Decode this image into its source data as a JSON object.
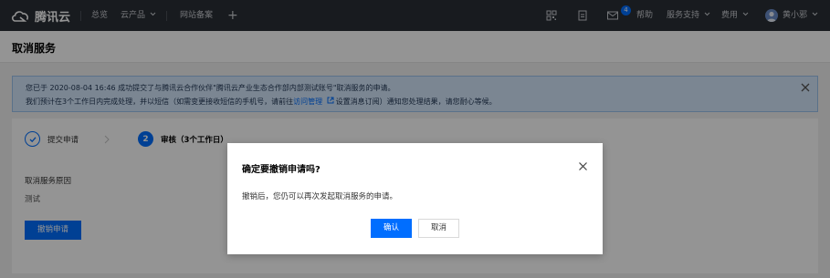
{
  "nav": {
    "brand": "腾讯云",
    "overview": "总览",
    "products": "云产品",
    "filing": "网站备案",
    "plus": "+",
    "message_count": "4",
    "help": "帮助",
    "support": "服务支持",
    "billing": "费用",
    "username": "黄小邪"
  },
  "page": {
    "title": "取消服务"
  },
  "notice": {
    "line1": "您已于 2020-08-04 16:46 成功提交了与腾讯云合作伙伴\"腾讯云产业生态合作部内部测试账号\"取消服务的申请。",
    "line2_before": "我们预计在3个工作日内完成处理，并以短信（如需变更接收短信的手机号，请前往",
    "line2_link": "访问管理",
    "line2_after": "设置消息订阅）通知您处理结果，请您耐心等候。"
  },
  "steps": [
    {
      "label": "提交申请"
    },
    {
      "number": "2",
      "label": "审核（3个工作日）"
    }
  ],
  "form": {
    "reason_label": "取消服务原因",
    "reason_value": "测试",
    "withdraw_button": "撤销申请"
  },
  "dialog": {
    "title": "确定要撤销申请吗?",
    "body": "撤销后，您仍可以再次发起取消服务的申请。",
    "confirm": "确认",
    "cancel": "取消"
  }
}
